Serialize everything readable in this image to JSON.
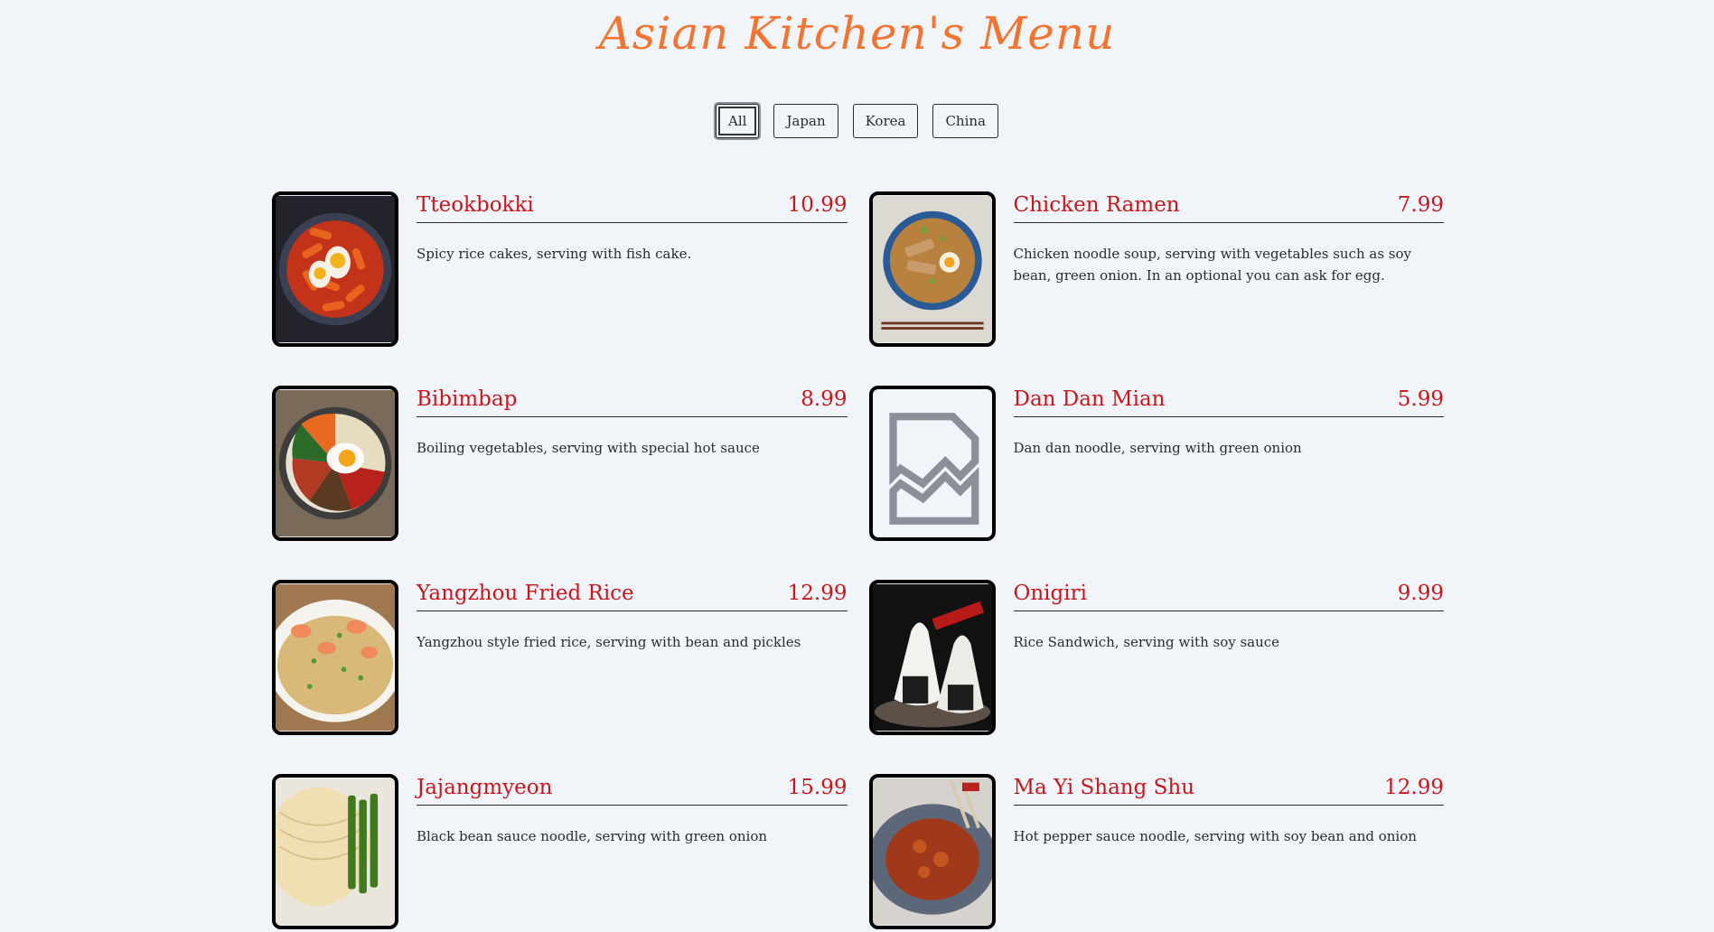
{
  "page": {
    "title": "Asian Kitchen's Menu"
  },
  "filters": [
    {
      "label": "All",
      "active": true
    },
    {
      "label": "Japan",
      "active": false
    },
    {
      "label": "Korea",
      "active": false
    },
    {
      "label": "China",
      "active": false
    }
  ],
  "items": [
    {
      "name": "Tteokbokki",
      "price": "10.99",
      "description": "Spicy rice cakes, serving with fish cake.",
      "image": "tteokbokki"
    },
    {
      "name": "Chicken Ramen",
      "price": "7.99",
      "description": "Chicken noodle soup, serving with vegetables such as soy bean, green onion. In an optional you can ask for egg.",
      "image": "ramen"
    },
    {
      "name": "Bibimbap",
      "price": "8.99",
      "description": "Boiling vegetables, serving with special hot sauce",
      "image": "bibimbap"
    },
    {
      "name": "Dan Dan Mian",
      "price": "5.99",
      "description": "Dan dan noodle, serving with green onion",
      "image": "broken"
    },
    {
      "name": "Yangzhou Fried Rice",
      "price": "12.99",
      "description": "Yangzhou style fried rice, serving with bean and pickles",
      "image": "friedrice"
    },
    {
      "name": "Onigiri",
      "price": "9.99",
      "description": "Rice Sandwich, serving with soy sauce",
      "image": "onigiri"
    },
    {
      "name": "Jajangmyeon",
      "price": "15.99",
      "description": "Black bean sauce noodle, serving with green onion",
      "image": "jajang"
    },
    {
      "name": "Ma Yi Shang Shu",
      "price": "12.99",
      "description": "Hot pepper sauce noodle, serving with soy bean and onion",
      "image": "mayi"
    }
  ],
  "colors": {
    "title": "#f27430",
    "accent": "#c8161b",
    "background": "#f1f4f8"
  }
}
